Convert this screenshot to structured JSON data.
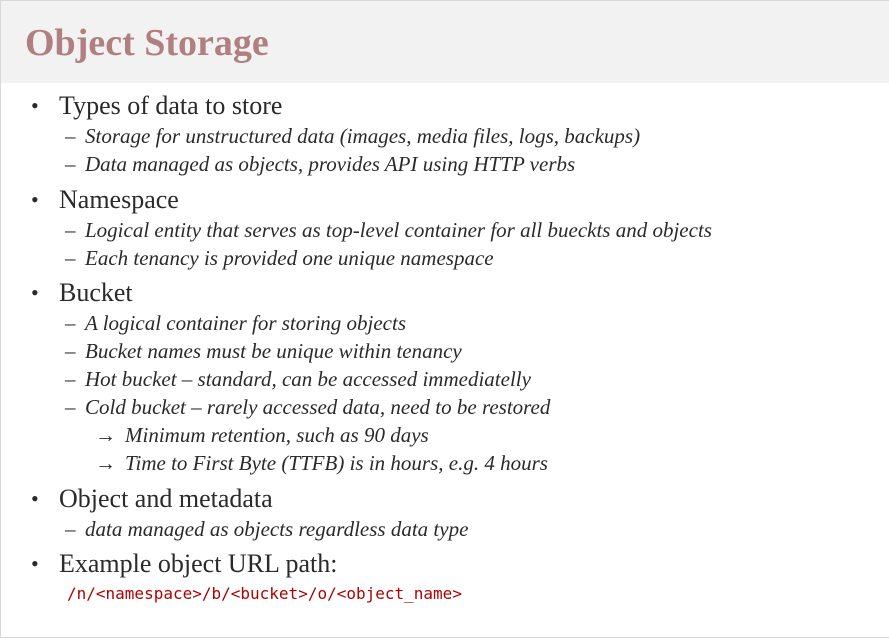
{
  "title": "Object Storage",
  "sections": [
    {
      "heading": "Types of data to store",
      "items": [
        "Storage for unstructured data (images, media files, logs, backups)",
        "Data managed as objects, provides API using HTTP verbs"
      ]
    },
    {
      "heading": "Namespace",
      "items": [
        "Logical entity that serves as top-level container for all bueckts and objects",
        "Each tenancy is provided one unique namespace"
      ]
    },
    {
      "heading": "Bucket",
      "items": [
        "A logical container for storing objects",
        "Bucket names must be unique within tenancy",
        "Hot bucket – standard, can be accessed immediatelly",
        "Cold bucket – rarely accessed data, need to be restored"
      ],
      "subitems": [
        "Minimum retention, such as 90 days",
        "Time to First Byte (TTFB) is in hours, e.g. 4 hours"
      ]
    },
    {
      "heading": "Object and metadata",
      "items": [
        "data managed as objects regardless data type"
      ]
    },
    {
      "heading": "Example object URL path:",
      "code": "/n/<namespace>/b/<bucket>/o/<object_name>"
    }
  ],
  "symbols": {
    "bullet": "•",
    "dash": "–",
    "arrow": "→"
  }
}
